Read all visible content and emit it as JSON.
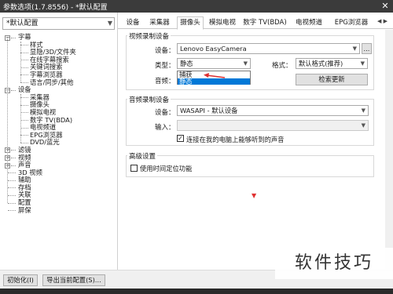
{
  "window": {
    "title": "参数选项(1.7.8556) - *默认配置",
    "close_label": "✕"
  },
  "left_pane": {
    "preset": "*默认配置",
    "tree": [
      {
        "label": "字幕",
        "level": 0,
        "expander": "−"
      },
      {
        "label": "样式",
        "level": 1
      },
      {
        "label": "显隐/3D/文件夹",
        "level": 1
      },
      {
        "label": "在线字幕搜索",
        "level": 1
      },
      {
        "label": "关键词搜索",
        "level": 1
      },
      {
        "label": "字幕浏览器",
        "level": 1
      },
      {
        "label": "语言/同步/其他",
        "level": 1
      },
      {
        "label": "设备",
        "level": 0,
        "expander": "−"
      },
      {
        "label": "采集器",
        "level": 1
      },
      {
        "label": "摄像头",
        "level": 1
      },
      {
        "label": "模拟电视",
        "level": 1
      },
      {
        "label": "数字 TV(BDA)",
        "level": 1
      },
      {
        "label": "电视频道",
        "level": 1
      },
      {
        "label": "EPG浏览器",
        "level": 1
      },
      {
        "label": "DVD/蓝光",
        "level": 1
      },
      {
        "label": "滤镜",
        "level": 0,
        "expander": "+"
      },
      {
        "label": "视频",
        "level": 0,
        "expander": "+"
      },
      {
        "label": "声音",
        "level": 0,
        "expander": "+"
      },
      {
        "label": "3D 视频",
        "level": 0
      },
      {
        "label": "辅助",
        "level": 0
      },
      {
        "label": "存档",
        "level": 0
      },
      {
        "label": "关联",
        "level": 0
      },
      {
        "label": "配置",
        "level": 0
      },
      {
        "label": "屏保",
        "level": 0
      }
    ]
  },
  "tabs": [
    "设备",
    "采集器",
    "摄像头",
    "模拟电视",
    "数字 TV(BDA)",
    "电视频道",
    "EPG浏览器"
  ],
  "active_tab": "摄像头",
  "video_group": {
    "title": "视频录制设备",
    "device_label": "设备：",
    "device_value": "Lenovo EasyCamera",
    "browse_label": "...",
    "type_label": "类型：",
    "type_value": "静态",
    "format_label": "格式：",
    "format_value": "默认格式(推荐)",
    "audio_label": "音频：",
    "refresh_label": "检索更新",
    "type_options": [
      "捕获",
      "静态"
    ],
    "type_selected": "静态"
  },
  "audio_group": {
    "title": "音频录制设备",
    "device_label": "设备：",
    "device_value": "WASAPI - 默认设备",
    "input_label": "输入：",
    "input_value": "",
    "loopback_label": "连接在我的电脑上能够听到的声音",
    "loopback_checked": true
  },
  "advanced_group": {
    "title": "高级设置",
    "timeshift_label": "使用时间定位功能",
    "timeshift_checked": false
  },
  "footer": {
    "init_label": "初始化(I)",
    "export_label": "导出当前配置(S)..."
  },
  "watermark": "软件技巧",
  "colors": {
    "selection": "#0078d7",
    "annotation_arrow": "#e03030",
    "titlebar": "#3b3b3b"
  }
}
